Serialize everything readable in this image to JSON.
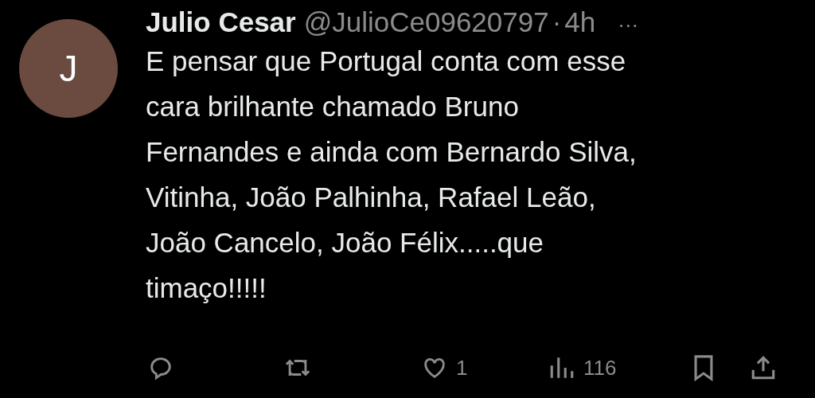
{
  "tweet": {
    "avatar_letter": "J",
    "author": "Julio Cesar",
    "handle": "@JulioCe09620797",
    "separator": "·",
    "time": "4h",
    "more": "···",
    "text": "E pensar que Portugal conta com esse\ncara brilhante chamado Bruno\nFernandes e ainda com Bernardo Silva,\nVitinha, João Palhinha, Rafael Leão,\nJoão Cancelo, João Félix.....que\ntimaço!!!!!"
  },
  "actions": [
    {
      "kind": "reply"
    },
    {
      "kind": "retweet"
    },
    {
      "kind": "like",
      "count": "1"
    },
    {
      "kind": "views",
      "count": "116"
    },
    {
      "kind": "bookmark"
    },
    {
      "kind": "share"
    }
  ]
}
